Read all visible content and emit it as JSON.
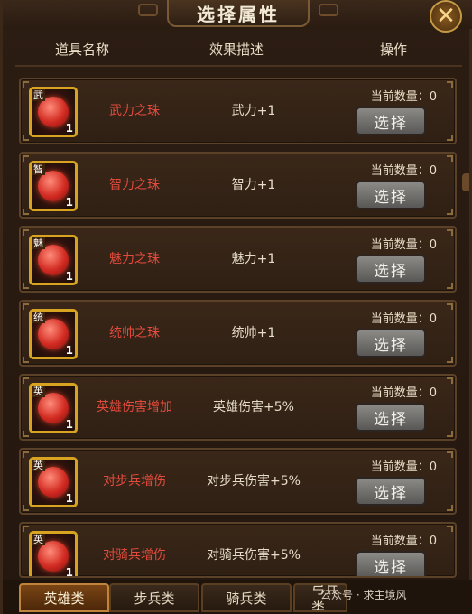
{
  "title": "选择属性",
  "close_label": "✕",
  "columns": {
    "name": "道具名称",
    "desc": "效果描述",
    "op": "操作"
  },
  "qty_label": "当前数量：0",
  "select_label": "选择",
  "items": [
    {
      "type": "武",
      "count": "1",
      "name": "武力之珠",
      "desc": "武力+1"
    },
    {
      "type": "智",
      "count": "1",
      "name": "智力之珠",
      "desc": "智力+1"
    },
    {
      "type": "魅",
      "count": "1",
      "name": "魅力之珠",
      "desc": "魅力+1"
    },
    {
      "type": "统",
      "count": "1",
      "name": "统帅之珠",
      "desc": "统帅+1"
    },
    {
      "type": "英",
      "count": "1",
      "name": "英雄伤害增加",
      "desc": "英雄伤害+5%"
    },
    {
      "type": "英",
      "count": "1",
      "name": "对步兵增伤",
      "desc": "对步兵伤害+5%"
    },
    {
      "type": "英",
      "count": "1",
      "name": "对骑兵增伤",
      "desc": "对骑兵伤害+5%"
    }
  ],
  "tabs": [
    "英雄类",
    "步兵类",
    "骑兵类",
    "弓兵类"
  ],
  "active_tab": "英雄类",
  "watermark": "公众号 · 求主境风",
  "colors": {
    "item_name": "#e24b3d",
    "frame_gold": "#d7a321",
    "active_tab": "#7a4515"
  }
}
